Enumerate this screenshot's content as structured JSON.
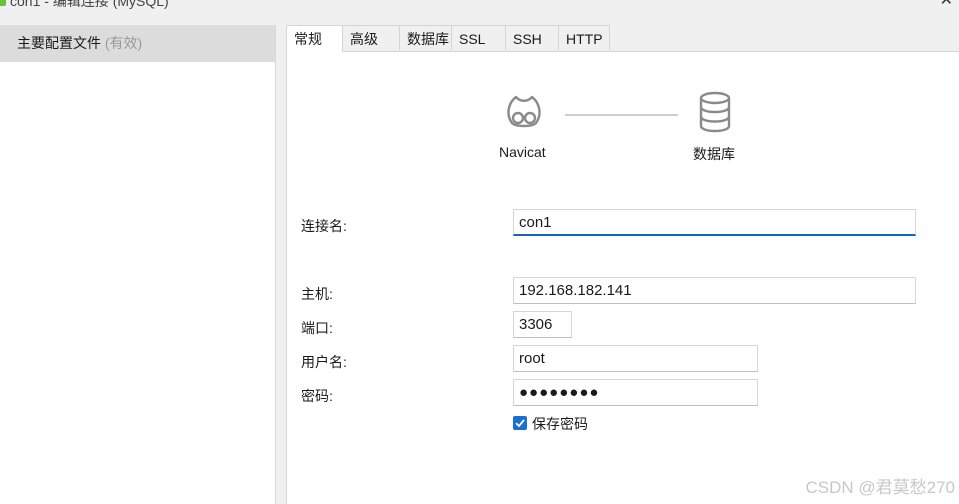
{
  "window": {
    "title": "con1 - 编辑连接 (MySQL)"
  },
  "sidebar": {
    "items": [
      {
        "label": "主要配置文件",
        "status": "(有效)"
      }
    ]
  },
  "tabs": [
    {
      "label": "常规",
      "active": true
    },
    {
      "label": "高级"
    },
    {
      "label": "数据库"
    },
    {
      "label": "SSL"
    },
    {
      "label": "SSH"
    },
    {
      "label": "HTTP"
    }
  ],
  "diagram": {
    "left_label": "Navicat",
    "right_label": "数据库",
    "left_icon": "navicat-logo-icon",
    "right_icon": "database-icon"
  },
  "form": {
    "connection_name": {
      "label": "连接名:",
      "value": "con1"
    },
    "host": {
      "label": "主机:",
      "value": "192.168.182.141"
    },
    "port": {
      "label": "端口:",
      "value": "3306"
    },
    "username": {
      "label": "用户名:",
      "value": "root"
    },
    "password": {
      "label": "密码:",
      "value": "●●●●●●●●"
    },
    "save_password": {
      "label": "保存密码",
      "checked": true
    }
  },
  "watermark": "CSDN @君莫愁270",
  "colors": {
    "accent": "#1565c0",
    "checkbox": "#1a6fd1",
    "selected_row": "#dcdcdc"
  }
}
